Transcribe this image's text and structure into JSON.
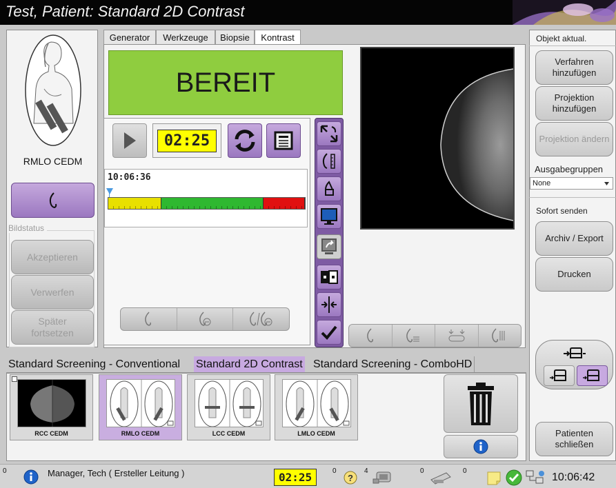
{
  "title": "Test, Patient:  Standard 2D Contrast",
  "patient_view": {
    "label": "RMLO CEDM"
  },
  "image_status": {
    "legend": "Bildstatus",
    "accept": "Akzeptieren",
    "reject": "Verwerfen",
    "pend": "Später fortsetzen"
  },
  "tabs": [
    "Generator",
    "Werkzeuge",
    "Biopsie",
    "Kontrast"
  ],
  "ready": {
    "text": "BEREIT",
    "color": "#8fcd3f"
  },
  "timer": {
    "countdown": "02:25",
    "start_time": "10:06:36",
    "progress_segments": [
      {
        "color": "#e8e000",
        "fraction": 0.27
      },
      {
        "color": "#2fb830",
        "fraction": 0.52
      },
      {
        "color": "#e01010",
        "fraction": 0.21
      }
    ]
  },
  "right_panel": {
    "update_header": "Objekt aktual.",
    "add_procedure": "Verfahren hinzufügen",
    "add_view": "Projektion hinzufügen",
    "edit_view": "Projektion ändern",
    "output_groups_label": "Ausgabegruppen",
    "output_group_value": "None",
    "send_now_label": "Sofort senden",
    "archive_export": "Archiv / Export",
    "print": "Drucken",
    "close_patient": "Patienten schließen"
  },
  "procedure_tabs": [
    "Standard Screening - Conventional",
    "Standard 2D Contrast",
    "Standard Screening - ComboHD"
  ],
  "thumbnails": [
    {
      "label": "RCC CEDM"
    },
    {
      "label": "RMLO CEDM"
    },
    {
      "label": "LCC CEDM"
    },
    {
      "label": "LMLO CEDM"
    }
  ],
  "status_bar": {
    "left_count": "0",
    "user": "Manager, Tech ( Ersteller Leitung )",
    "countdown": "02:25",
    "count1": "0",
    "count2": "4",
    "count3": "0",
    "count4": "0",
    "time": "10:06:42"
  },
  "colors": {
    "accent_purple": "#b89ad6",
    "selected_tab": "#c7a9e0",
    "timer_bg": "#ffff00"
  },
  "icons": [
    "play-icon",
    "refresh-icon",
    "memo-icon",
    "info-icon",
    "trash-icon",
    "checkmark-icon"
  ]
}
